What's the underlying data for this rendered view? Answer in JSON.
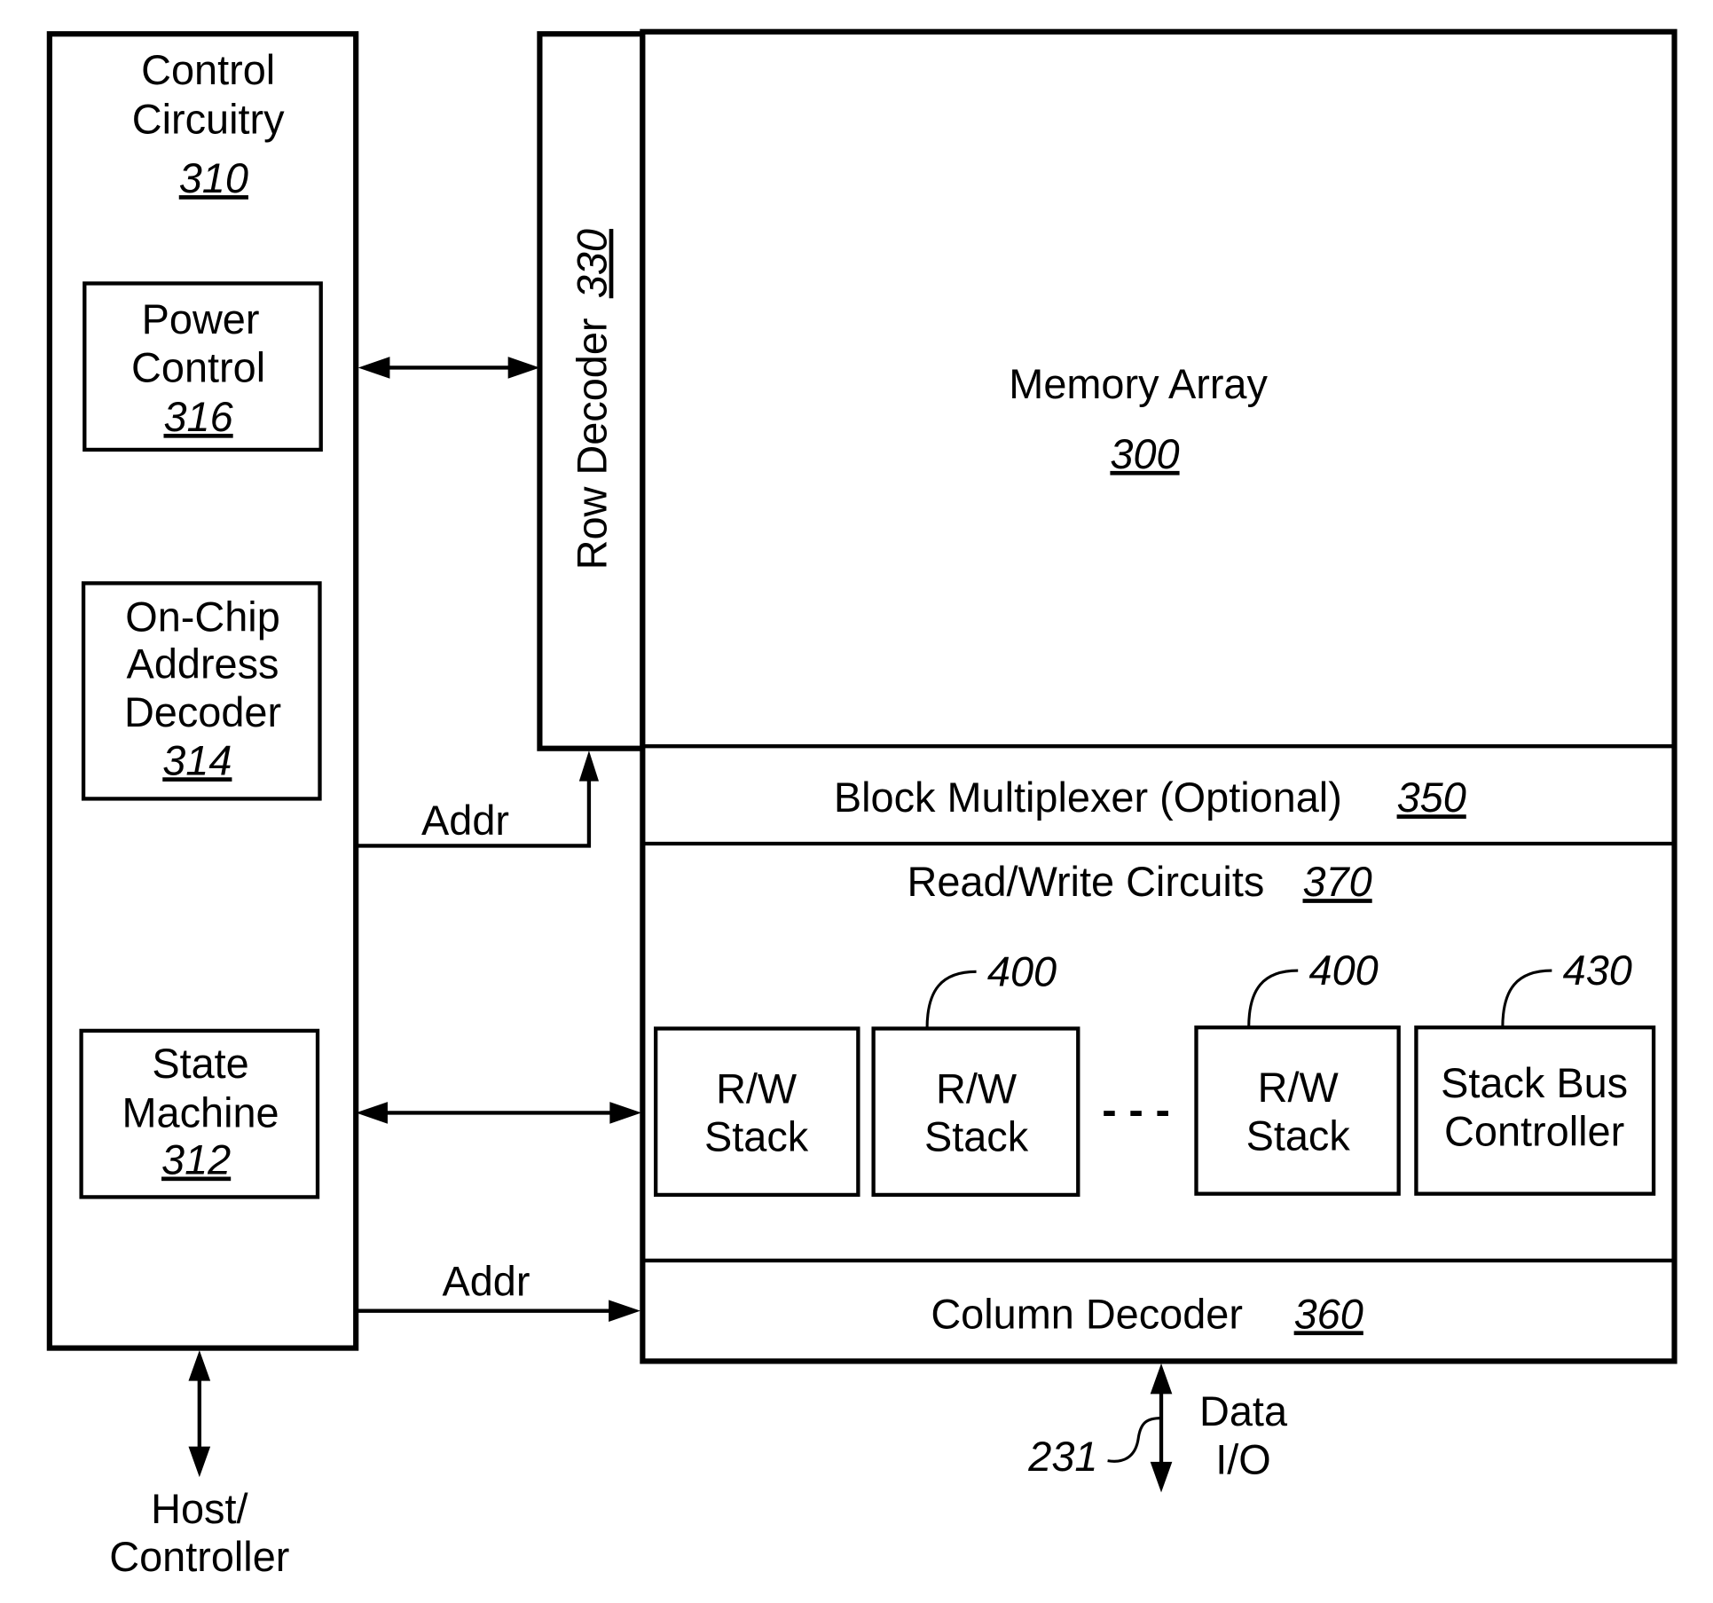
{
  "control_circuitry": {
    "title_line1": "Control",
    "title_line2": "Circuitry",
    "ref": "310"
  },
  "power_control": {
    "line1": "Power",
    "line2": "Control",
    "ref": "316"
  },
  "address_decoder": {
    "line1": "On-Chip",
    "line2": "Address",
    "line3": "Decoder",
    "ref": "314"
  },
  "state_machine": {
    "line1": "State",
    "line2": "Machine",
    "ref": "312"
  },
  "row_decoder": {
    "label": "Row Decoder",
    "ref": "330"
  },
  "memory_array": {
    "label": "Memory Array",
    "ref": "300"
  },
  "block_mux": {
    "label": "Block Multiplexer (Optional)",
    "ref": "350"
  },
  "rw_circuits": {
    "label": "Read/Write Circuits",
    "ref": "370"
  },
  "rw_stacks": [
    {
      "line1": "R/W",
      "line2": "Stack",
      "ref": "400"
    },
    {
      "line1": "R/W",
      "line2": "Stack",
      "ref": "400"
    }
  ],
  "ellipsis": "- - -",
  "stack_bus_controller": {
    "line1": "Stack Bus",
    "line2": "Controller",
    "ref": "430"
  },
  "column_decoder": {
    "label": "Column Decoder",
    "ref": "360"
  },
  "signals": {
    "addr_top": "Addr",
    "addr_bottom": "Addr"
  },
  "data_io": {
    "line1": "Data",
    "line2": "I/O",
    "ref": "231"
  },
  "host": {
    "line1": "Host/",
    "line2": "Controller"
  }
}
